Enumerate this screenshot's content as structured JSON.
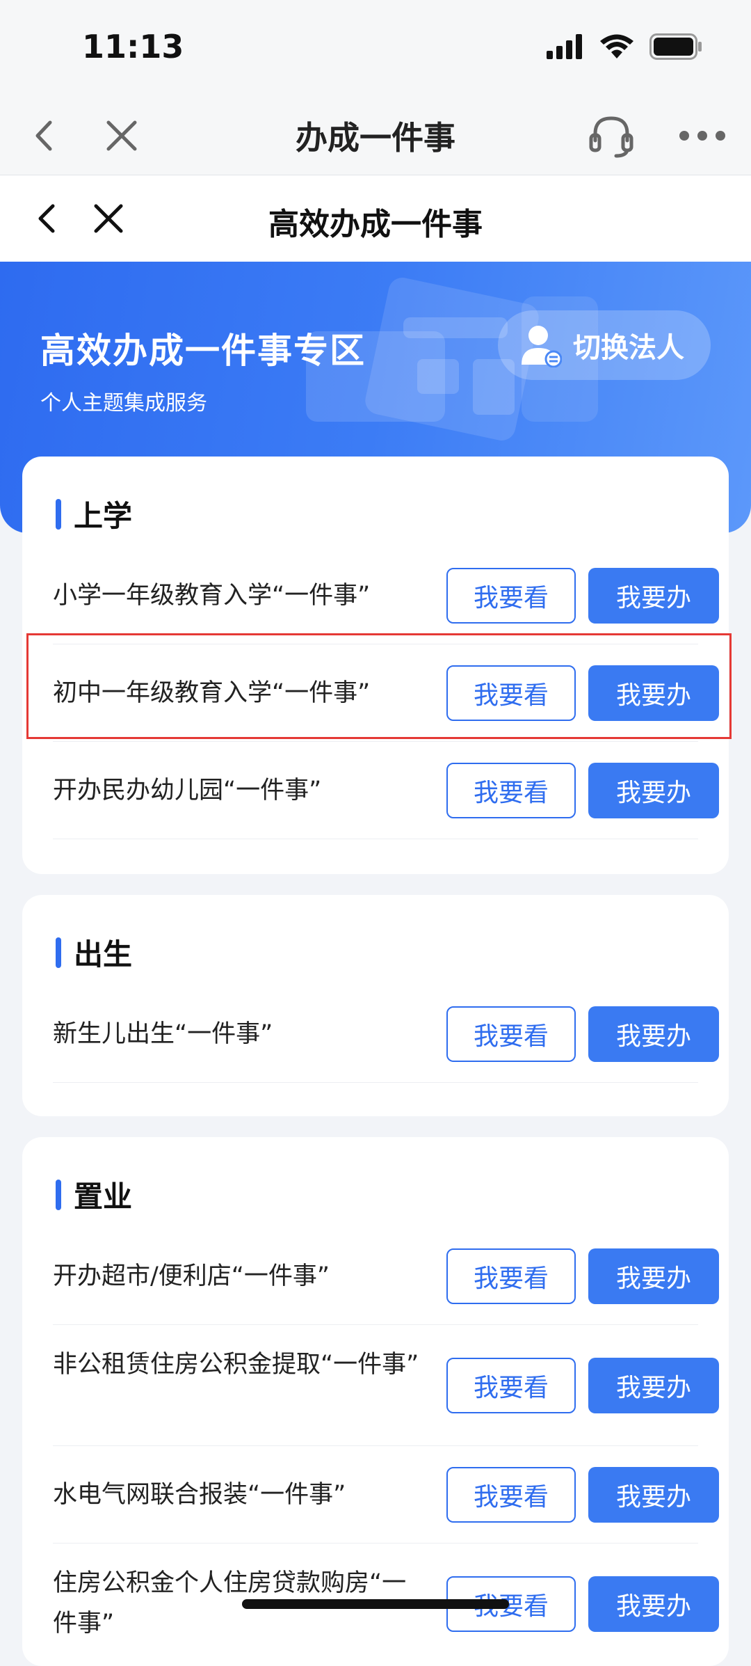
{
  "status_bar": {
    "time": "11:13"
  },
  "nav": {
    "title": "办成一件事"
  },
  "sub_nav": {
    "title": "高效办成一件事"
  },
  "banner": {
    "title": "高效办成一件事专区",
    "subtitle": "个人主题集成服务",
    "switch_label": "切换法人"
  },
  "button_labels": {
    "view": "我要看",
    "do": "我要办"
  },
  "sections": [
    {
      "title": "上学",
      "items": [
        "小学一年级教育入学“一件事”",
        "初中一年级教育入学“一件事”",
        "开办民办幼儿园“一件事”"
      ]
    },
    {
      "title": "出生",
      "items": [
        "新生儿出生“一件事”"
      ]
    },
    {
      "title": "置业",
      "items": [
        "开办超市/便利店“一件事”",
        "非公租赁住房公积金提取“一件事”",
        "水电气网联合报装“一件事”",
        "住房公积金个人住房贷款购房“一件事”"
      ]
    }
  ],
  "colors": {
    "accent": "#2F6DEF",
    "highlight": "#E53935"
  }
}
